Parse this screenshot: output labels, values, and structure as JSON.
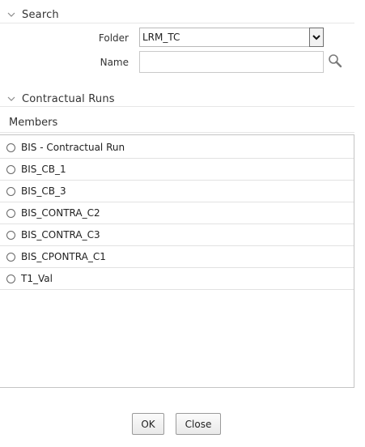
{
  "search_section": {
    "title": "Search",
    "folder_label": "Folder",
    "folder_value": "LRM_TC",
    "name_label": "Name",
    "name_value": "",
    "name_placeholder": ""
  },
  "runs_section": {
    "title": "Contractual Runs",
    "members_label": "Members",
    "items": [
      {
        "label": "BIS - Contractual Run"
      },
      {
        "label": "BIS_CB_1"
      },
      {
        "label": "BIS_CB_3"
      },
      {
        "label": "BIS_CONTRA_C2"
      },
      {
        "label": "BIS_CONTRA_C3"
      },
      {
        "label": "BIS_CPONTRA_C1"
      },
      {
        "label": "T1_Val"
      }
    ]
  },
  "buttons": {
    "ok": "OK",
    "close": "Close"
  },
  "icons": {
    "collapse": "chevron-down-icon",
    "dropdown": "chevron-down-icon",
    "search": "search-icon"
  }
}
